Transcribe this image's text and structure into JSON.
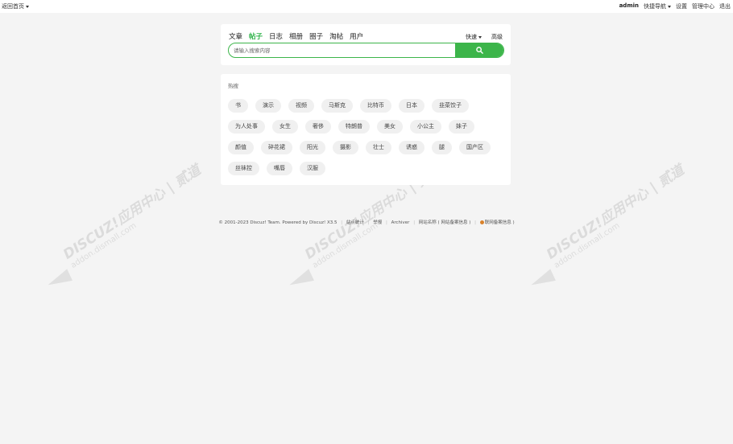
{
  "topbar": {
    "back_home": "返回首页",
    "user": "admin",
    "quick_nav": "快捷导航",
    "settings": "设置",
    "admin_center": "管理中心",
    "logout": "退出"
  },
  "search": {
    "tabs": [
      {
        "label": "文章",
        "active": false
      },
      {
        "label": "帖子",
        "active": true
      },
      {
        "label": "日志",
        "active": false
      },
      {
        "label": "相册",
        "active": false
      },
      {
        "label": "圈子",
        "active": false
      },
      {
        "label": "淘帖",
        "active": false
      },
      {
        "label": "用户",
        "active": false
      }
    ],
    "quick_label": "快速",
    "advanced_label": "高级",
    "placeholder": "请输入搜索内容",
    "accent_color": "#3cb54a"
  },
  "hot": {
    "title": "热搜",
    "rows": [
      [
        "书",
        "演示",
        "视频",
        "马斯克",
        "比特币",
        "日本",
        "韭菜饺子"
      ],
      [
        "为人处事",
        "女生",
        "奢侈",
        "特朗普",
        "美女",
        "小公主",
        "妹子"
      ],
      [
        "颜值",
        "碎花裙",
        "阳光",
        "摄影",
        "壮士",
        "诱惑",
        "腿",
        "国产区"
      ],
      [
        "丝袜控",
        "嘴唇",
        "汉服"
      ]
    ]
  },
  "footer": {
    "copyright": "© 2001-2023 Discuz! Team. Powered by Discuz! X3.5",
    "links": [
      "站点统计",
      "举报",
      "Archiver",
      "网站名称 ( 网站备案信息 )"
    ],
    "police": "联网备案信息 )"
  },
  "watermark": {
    "line1": "DISCUZ!应用中心 | 贰道",
    "line2": "addon.dismall.com"
  }
}
